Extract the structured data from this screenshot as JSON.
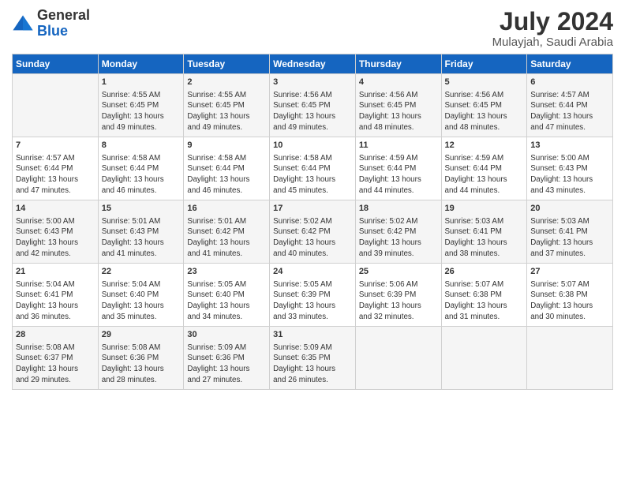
{
  "header": {
    "logo_general": "General",
    "logo_blue": "Blue",
    "month_title": "July 2024",
    "location": "Mulayjah, Saudi Arabia"
  },
  "days_of_week": [
    "Sunday",
    "Monday",
    "Tuesday",
    "Wednesday",
    "Thursday",
    "Friday",
    "Saturday"
  ],
  "weeks": [
    [
      {
        "day": "",
        "info": ""
      },
      {
        "day": "1",
        "info": "Sunrise: 4:55 AM\nSunset: 6:45 PM\nDaylight: 13 hours\nand 49 minutes."
      },
      {
        "day": "2",
        "info": "Sunrise: 4:55 AM\nSunset: 6:45 PM\nDaylight: 13 hours\nand 49 minutes."
      },
      {
        "day": "3",
        "info": "Sunrise: 4:56 AM\nSunset: 6:45 PM\nDaylight: 13 hours\nand 49 minutes."
      },
      {
        "day": "4",
        "info": "Sunrise: 4:56 AM\nSunset: 6:45 PM\nDaylight: 13 hours\nand 48 minutes."
      },
      {
        "day": "5",
        "info": "Sunrise: 4:56 AM\nSunset: 6:45 PM\nDaylight: 13 hours\nand 48 minutes."
      },
      {
        "day": "6",
        "info": "Sunrise: 4:57 AM\nSunset: 6:44 PM\nDaylight: 13 hours\nand 47 minutes."
      }
    ],
    [
      {
        "day": "7",
        "info": "Sunrise: 4:57 AM\nSunset: 6:44 PM\nDaylight: 13 hours\nand 47 minutes."
      },
      {
        "day": "8",
        "info": "Sunrise: 4:58 AM\nSunset: 6:44 PM\nDaylight: 13 hours\nand 46 minutes."
      },
      {
        "day": "9",
        "info": "Sunrise: 4:58 AM\nSunset: 6:44 PM\nDaylight: 13 hours\nand 46 minutes."
      },
      {
        "day": "10",
        "info": "Sunrise: 4:58 AM\nSunset: 6:44 PM\nDaylight: 13 hours\nand 45 minutes."
      },
      {
        "day": "11",
        "info": "Sunrise: 4:59 AM\nSunset: 6:44 PM\nDaylight: 13 hours\nand 44 minutes."
      },
      {
        "day": "12",
        "info": "Sunrise: 4:59 AM\nSunset: 6:44 PM\nDaylight: 13 hours\nand 44 minutes."
      },
      {
        "day": "13",
        "info": "Sunrise: 5:00 AM\nSunset: 6:43 PM\nDaylight: 13 hours\nand 43 minutes."
      }
    ],
    [
      {
        "day": "14",
        "info": "Sunrise: 5:00 AM\nSunset: 6:43 PM\nDaylight: 13 hours\nand 42 minutes."
      },
      {
        "day": "15",
        "info": "Sunrise: 5:01 AM\nSunset: 6:43 PM\nDaylight: 13 hours\nand 41 minutes."
      },
      {
        "day": "16",
        "info": "Sunrise: 5:01 AM\nSunset: 6:42 PM\nDaylight: 13 hours\nand 41 minutes."
      },
      {
        "day": "17",
        "info": "Sunrise: 5:02 AM\nSunset: 6:42 PM\nDaylight: 13 hours\nand 40 minutes."
      },
      {
        "day": "18",
        "info": "Sunrise: 5:02 AM\nSunset: 6:42 PM\nDaylight: 13 hours\nand 39 minutes."
      },
      {
        "day": "19",
        "info": "Sunrise: 5:03 AM\nSunset: 6:41 PM\nDaylight: 13 hours\nand 38 minutes."
      },
      {
        "day": "20",
        "info": "Sunrise: 5:03 AM\nSunset: 6:41 PM\nDaylight: 13 hours\nand 37 minutes."
      }
    ],
    [
      {
        "day": "21",
        "info": "Sunrise: 5:04 AM\nSunset: 6:41 PM\nDaylight: 13 hours\nand 36 minutes."
      },
      {
        "day": "22",
        "info": "Sunrise: 5:04 AM\nSunset: 6:40 PM\nDaylight: 13 hours\nand 35 minutes."
      },
      {
        "day": "23",
        "info": "Sunrise: 5:05 AM\nSunset: 6:40 PM\nDaylight: 13 hours\nand 34 minutes."
      },
      {
        "day": "24",
        "info": "Sunrise: 5:05 AM\nSunset: 6:39 PM\nDaylight: 13 hours\nand 33 minutes."
      },
      {
        "day": "25",
        "info": "Sunrise: 5:06 AM\nSunset: 6:39 PM\nDaylight: 13 hours\nand 32 minutes."
      },
      {
        "day": "26",
        "info": "Sunrise: 5:07 AM\nSunset: 6:38 PM\nDaylight: 13 hours\nand 31 minutes."
      },
      {
        "day": "27",
        "info": "Sunrise: 5:07 AM\nSunset: 6:38 PM\nDaylight: 13 hours\nand 30 minutes."
      }
    ],
    [
      {
        "day": "28",
        "info": "Sunrise: 5:08 AM\nSunset: 6:37 PM\nDaylight: 13 hours\nand 29 minutes."
      },
      {
        "day": "29",
        "info": "Sunrise: 5:08 AM\nSunset: 6:36 PM\nDaylight: 13 hours\nand 28 minutes."
      },
      {
        "day": "30",
        "info": "Sunrise: 5:09 AM\nSunset: 6:36 PM\nDaylight: 13 hours\nand 27 minutes."
      },
      {
        "day": "31",
        "info": "Sunrise: 5:09 AM\nSunset: 6:35 PM\nDaylight: 13 hours\nand 26 minutes."
      },
      {
        "day": "",
        "info": ""
      },
      {
        "day": "",
        "info": ""
      },
      {
        "day": "",
        "info": ""
      }
    ]
  ]
}
